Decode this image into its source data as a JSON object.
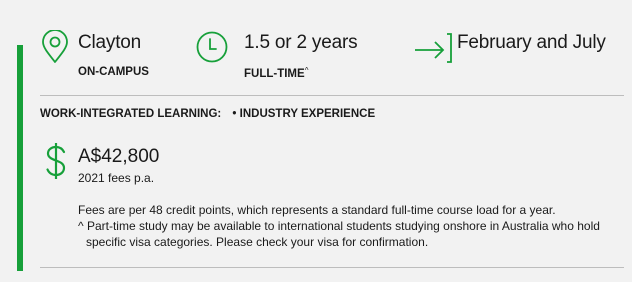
{
  "theme": {
    "accent": "#17a03a",
    "background": "#f2f2f2",
    "text": "#1a1a1a"
  },
  "facts": {
    "location": {
      "icon": "map-pin-icon",
      "value": "Clayton",
      "mode": "ON-CAMPUS"
    },
    "duration": {
      "icon": "clock-icon",
      "value": "1.5 or 2 years",
      "mode": "FULL-TIME",
      "footnote_mark": "^"
    },
    "intake": {
      "icon": "arrow-right-bracket-icon",
      "value": "February and July"
    }
  },
  "wil": {
    "label": "WORK-INTEGRATED LEARNING:",
    "item": "INDUSTRY EXPERIENCE"
  },
  "fees": {
    "icon": "dollar-icon",
    "amount": "A$42,800",
    "year": "2021 fees p.a.",
    "note": "Fees are per 48 credit points, which represents a standard full-time course load for a year.",
    "parttime_note": "^ Part-time study may be available to international students studying onshore in Australia who hold specific visa categories. Please check your visa for confirmation."
  }
}
